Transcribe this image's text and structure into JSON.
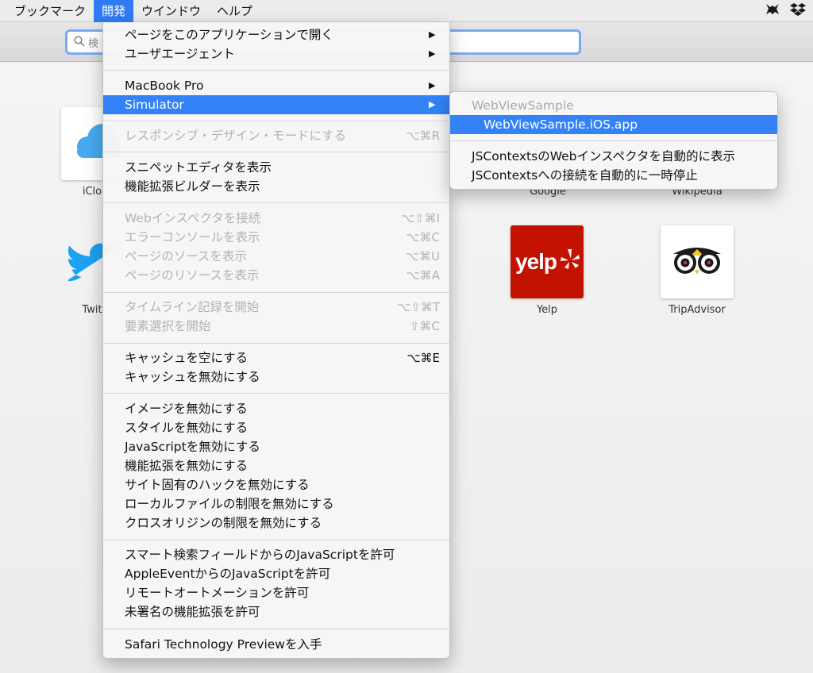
{
  "menubar": {
    "items": [
      "ブックマーク",
      "開発",
      "ウインドウ",
      "ヘルプ"
    ],
    "active_index": 1,
    "status_icons": [
      "bug-icon",
      "dropbox-icon"
    ]
  },
  "toolbar": {
    "search_placeholder": "検"
  },
  "favorites": [
    {
      "label": "iClo",
      "icon": "icloud-icon"
    },
    {
      "label": "Google",
      "icon": "google-icon"
    },
    {
      "label": "Wikipedia",
      "icon": "wikipedia-icon"
    },
    {
      "label": "Twit",
      "icon": "twitter-icon"
    },
    {
      "label": "Yelp",
      "icon": "yelp-logo",
      "brand_color": "#c41200",
      "logo_text": "yelp"
    },
    {
      "label": "TripAdvisor",
      "icon": "tripadvisor-owl-icon"
    }
  ],
  "menu": {
    "items": [
      {
        "label": "ページをこのアプリケーションで開く",
        "submenu": true,
        "enabled": true
      },
      {
        "label": "ユーザエージェント",
        "submenu": true,
        "enabled": true
      },
      {
        "label": "MacBook Pro",
        "submenu": true,
        "enabled": true
      },
      {
        "label": "Simulator",
        "submenu": true,
        "enabled": true,
        "highlighted": true
      },
      {
        "label": "レスポンシブ・デザイン・モードにする",
        "shortcut": "⌥⌘R",
        "enabled": false
      },
      {
        "label": "スニペットエディタを表示",
        "enabled": true
      },
      {
        "label": "機能拡張ビルダーを表示",
        "enabled": true
      },
      {
        "label": "Webインスペクタを接続",
        "shortcut": "⌥⇧⌘I",
        "enabled": false
      },
      {
        "label": "エラーコンソールを表示",
        "shortcut": "⌥⌘C",
        "enabled": false
      },
      {
        "label": "ページのソースを表示",
        "shortcut": "⌥⌘U",
        "enabled": false
      },
      {
        "label": "ページのリソースを表示",
        "shortcut": "⌥⌘A",
        "enabled": false
      },
      {
        "label": "タイムライン記録を開始",
        "shortcut": "⌥⇧⌘T",
        "enabled": false
      },
      {
        "label": "要素選択を開始",
        "shortcut": "⇧⌘C",
        "enabled": false
      },
      {
        "label": "キャッシュを空にする",
        "shortcut": "⌥⌘E",
        "enabled": true
      },
      {
        "label": "キャッシュを無効にする",
        "enabled": true
      },
      {
        "label": "イメージを無効にする",
        "enabled": true
      },
      {
        "label": "スタイルを無効にする",
        "enabled": true
      },
      {
        "label": "JavaScriptを無効にする",
        "enabled": true
      },
      {
        "label": "機能拡張を無効にする",
        "enabled": true
      },
      {
        "label": "サイト固有のハックを無効にする",
        "enabled": true
      },
      {
        "label": "ローカルファイルの制限を無効にする",
        "enabled": true
      },
      {
        "label": "クロスオリジンの制限を無効にする",
        "enabled": true
      },
      {
        "label": "スマート検索フィールドからのJavaScriptを許可",
        "enabled": true
      },
      {
        "label": "AppleEventからのJavaScriptを許可",
        "enabled": true
      },
      {
        "label": "リモートオートメーションを許可",
        "enabled": true
      },
      {
        "label": "未署名の機能拡張を許可",
        "enabled": true
      },
      {
        "label": "Safari Technology Previewを入手",
        "enabled": true
      }
    ]
  },
  "submenu": {
    "header": "WebViewSample",
    "selected": "WebViewSample.iOS.app",
    "items": [
      "JSContextsのWebインスペクタを自動的に表示",
      "JSContextsへの接続を自動的に一時停止"
    ]
  },
  "colors": {
    "highlight": "#3382f7",
    "menubar_active": "#2f7bf2",
    "disabled_text": "#b3b3b3"
  }
}
